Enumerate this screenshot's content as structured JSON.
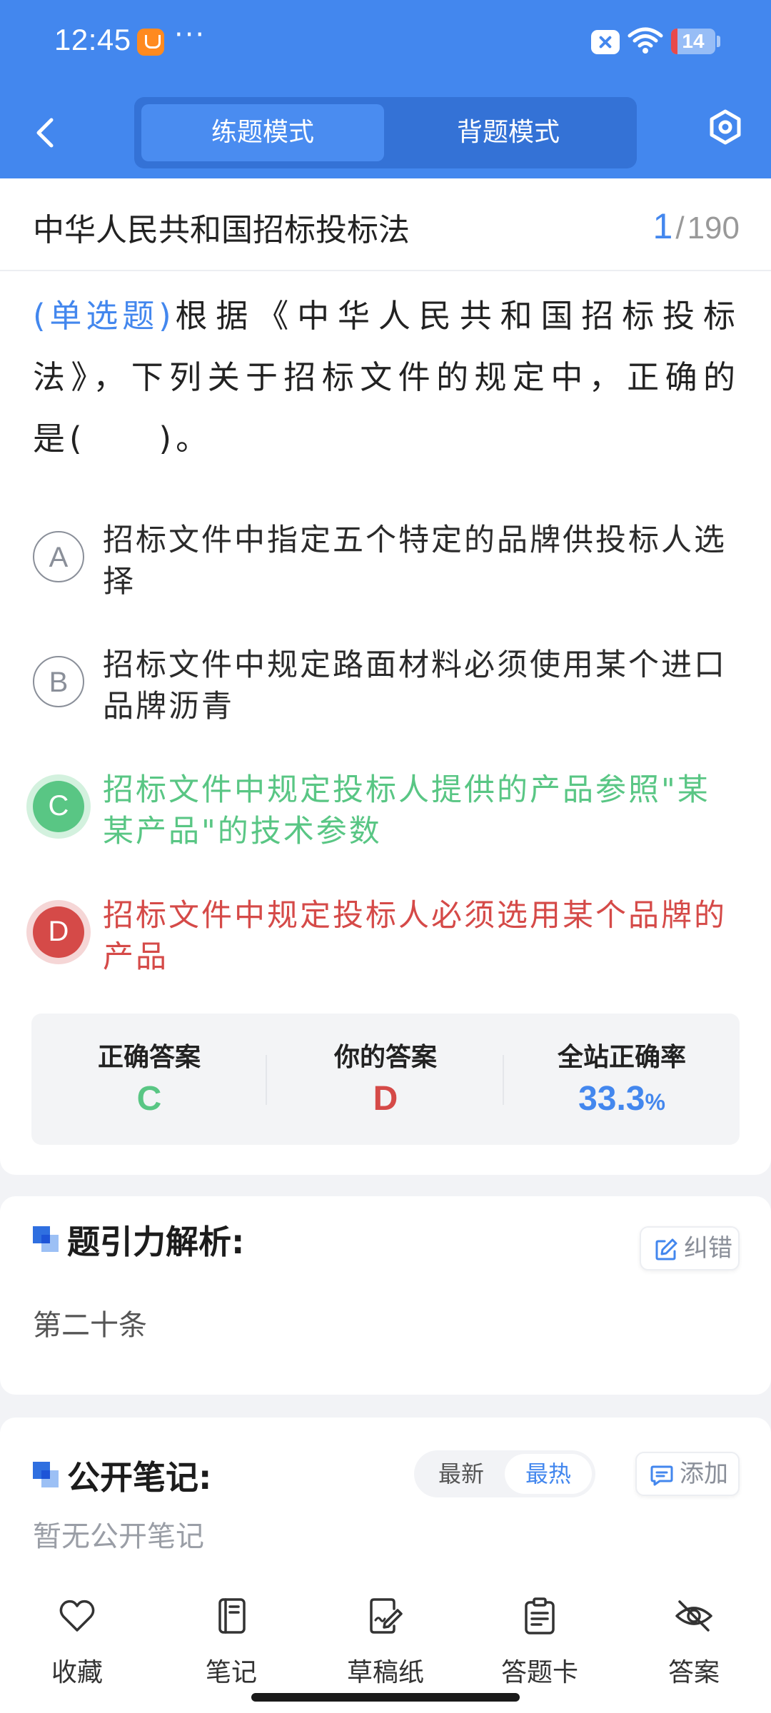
{
  "status_bar": {
    "time": "12:45",
    "more": "···",
    "battery": "14",
    "battery_level": 0.14
  },
  "header": {
    "tabs": [
      {
        "label": "练题模式",
        "active": true
      },
      {
        "label": "背题模式",
        "active": false
      }
    ]
  },
  "chapter": {
    "title": "中华人民共和国招标投标法",
    "current": "1",
    "separator": "/",
    "total": "190"
  },
  "question": {
    "type": "(单选题)",
    "text": "根据《中华人民共和国招标投标法》，下列关于招标文件的规定中，正确的是(　　)。"
  },
  "options": [
    {
      "letter": "A",
      "text": "招标文件中指定五个特定的品牌供投标人选择",
      "state": "normal"
    },
    {
      "letter": "B",
      "text": "招标文件中规定路面材料必须使用某个进口品牌沥青",
      "state": "normal"
    },
    {
      "letter": "C",
      "text": "招标文件中规定投标人提供的产品参照\"某某产品\"的技术参数",
      "state": "correct"
    },
    {
      "letter": "D",
      "text": "招标文件中规定投标人必须选用某个品牌的产品",
      "state": "wrong"
    }
  ],
  "watermark": "题引力",
  "answer_summary": {
    "correct_label": "正确答案",
    "correct_value": "C",
    "yours_label": "你的答案",
    "yours_value": "D",
    "rate_label": "全站正确率",
    "rate_value": "33.3",
    "rate_unit": "%"
  },
  "analysis": {
    "title": "题引力解析:",
    "report_label": "纠错",
    "text": "第二十条"
  },
  "notes": {
    "title": "公开笔记:",
    "sort_options": [
      "最新",
      "最热"
    ],
    "add_label": "添加",
    "empty_text": "暂无公开笔记"
  },
  "bottom_bar": [
    {
      "label": "收藏",
      "icon": "heart-icon"
    },
    {
      "label": "笔记",
      "icon": "notebook-icon"
    },
    {
      "label": "草稿纸",
      "icon": "draft-icon"
    },
    {
      "label": "答题卡",
      "icon": "clipboard-icon"
    },
    {
      "label": "答案",
      "icon": "eye-off-icon"
    }
  ],
  "colors": {
    "primary": "#4387ee",
    "correct": "#59c684",
    "wrong": "#d54a48"
  }
}
